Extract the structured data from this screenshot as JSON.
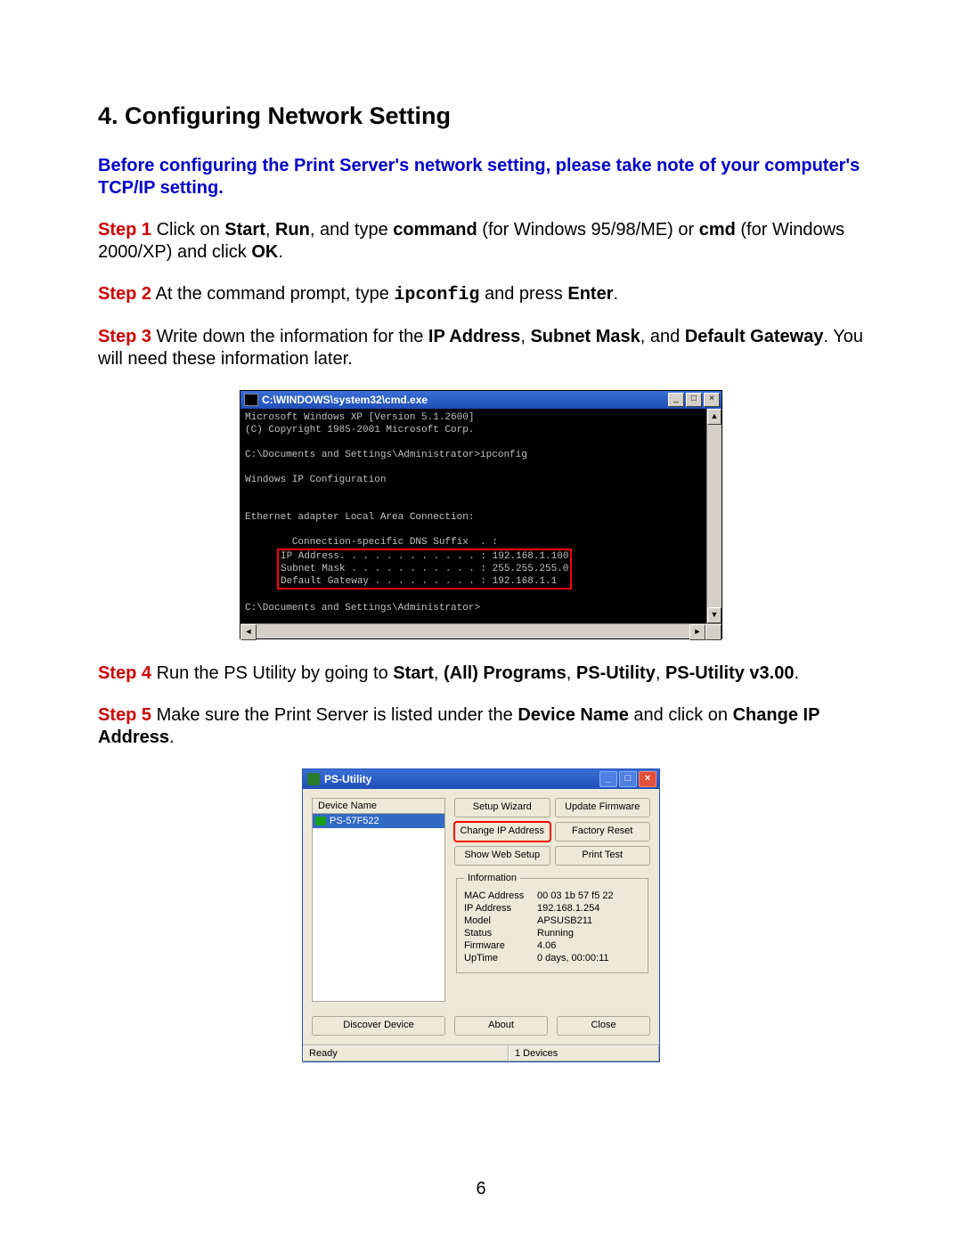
{
  "heading": "4. Configuring Network Setting",
  "intro": "Before configuring the Print Server's network setting, please take note of your computer's TCP/IP setting.",
  "steps": {
    "s1": {
      "label": "Step 1",
      "pre": " Click on ",
      "b1": "Start",
      "c1": ", ",
      "b2": "Run",
      "c2": ", and type ",
      "b3": "command",
      "c3": " (for Windows 95/98/ME) or ",
      "b4": "cmd",
      "c4": " (for Windows 2000/XP) and click ",
      "b5": "OK",
      "c5": "."
    },
    "s2": {
      "label": "Step 2",
      "pre": " At the command prompt, type ",
      "code": "ipconfig",
      "c1": " and press ",
      "b1": "Enter",
      "c2": "."
    },
    "s3": {
      "label": "Step 3",
      "pre": " Write down the information for the ",
      "b1": "IP Address",
      "c1": ", ",
      "b2": "Subnet Mask",
      "c2": ", and ",
      "b3": "Default Gateway",
      "c3": ". You will need these information later."
    },
    "s4": {
      "label": "Step 4",
      "pre": " Run the PS Utility by going to ",
      "b1": "Start",
      "c1": ", ",
      "b2": "(All) Programs",
      "c2": ", ",
      "b3": "PS-Utility",
      "c3": ", ",
      "b4": "PS-Utility v3.00",
      "c4": "."
    },
    "s5": {
      "label": "Step 5",
      "pre": " Make sure the Print Server is listed under the ",
      "b1": "Device Name",
      "c1": " and click on ",
      "b2": "Change IP Address",
      "c2": "."
    }
  },
  "cmd": {
    "title": "C:\\WINDOWS\\system32\\cmd.exe",
    "line1": "Microsoft Windows XP [Version 5.1.2600]",
    "line2": "(C) Copyright 1985-2001 Microsoft Corp.",
    "line3": "C:\\Documents and Settings\\Administrator>ipconfig",
    "line4": "Windows IP Configuration",
    "line5": "Ethernet adapter Local Area Connection:",
    "line6": "        Connection-specific DNS Suffix  . :",
    "hl1": "IP Address. . . . . . . . . . . . : 192.168.1.100",
    "hl2": "Subnet Mask . . . . . . . . . . . : 255.255.255.0",
    "hl3": "Default Gateway . . . . . . . . . : 192.168.1.1",
    "line7": "C:\\Documents and Settings\\Administrator>"
  },
  "psu": {
    "title": "PS-Utility",
    "device_header": "Device Name",
    "device": "PS-57F522",
    "buttons": {
      "setup_wizard": "Setup Wizard",
      "update_firmware": "Update Firmware",
      "change_ip": "Change IP Address",
      "factory_reset": "Factory Reset",
      "show_web": "Show Web Setup",
      "print_test": "Print Test",
      "discover": "Discover Device",
      "about": "About",
      "close": "Close"
    },
    "info_legend": "Information",
    "info": {
      "mac_l": "MAC Address",
      "mac_v": "00 03 1b 57 f5 22",
      "ip_l": "IP Address",
      "ip_v": "192.168.1.254",
      "model_l": "Model",
      "model_v": "APSUSB211",
      "status_l": "Status",
      "status_v": "Running",
      "fw_l": "Firmware",
      "fw_v": "4.06",
      "up_l": "UpTime",
      "up_v": "0 days, 00:00:11"
    },
    "status_ready": "Ready",
    "status_devices": "1 Devices"
  },
  "page_number": "6"
}
